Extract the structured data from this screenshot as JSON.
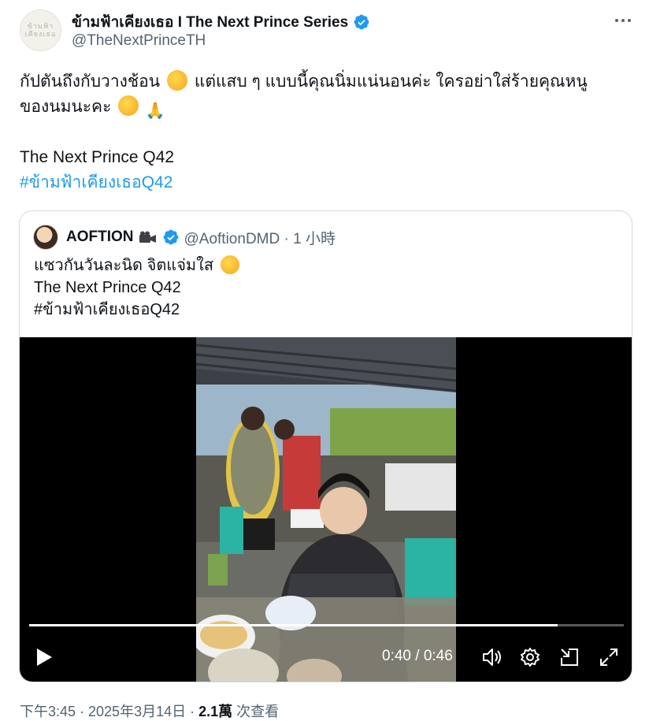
{
  "author": {
    "display_name": "ข้ามฟ้าเคียงเธอ I The Next Prince Series",
    "handle": "@TheNextPrinceTH",
    "avatar_logo_text": "ข้ามฟ้า เคียงเธอ",
    "verified_icon": "verified-badge-icon",
    "more_icon": "more-options-icon"
  },
  "tweet": {
    "line1_a": "กัปตันถึงกับวางช้อน",
    "line1_b": "แต่แสบ ๆ แบบนี้คุณนิ่มแน่นอนค่ะ ใครอย่าใส่ร้ายคุณหนู",
    "line2": "ของนมนะคะ",
    "line3": "The Next Prince Q42",
    "hashtag": "#ข้ามฟ้าเคียงเธอQ42"
  },
  "quoted": {
    "display_name": "AOFTION",
    "handle_time": "@AoftionDMD · 1 小時",
    "text_line1": "แซวกันวันละนิด จิตแจ่มใส",
    "text_line2": "The Next Prince Q42",
    "hashtag": "#ข้ามฟ้าเคียงเธอQ42",
    "video": {
      "time": "0:40 / 0:46",
      "progress": 0.889,
      "controls": [
        "play-icon",
        "volume-icon",
        "settings-icon",
        "picture-in-picture-icon",
        "fullscreen-icon"
      ]
    }
  },
  "footer": {
    "timestamp": "下午3:45 · 2025年3月14日 · ",
    "views_count": "2.1萬",
    "views_label": " 次查看"
  },
  "colors": {
    "accent": "#1d9bf0",
    "text": "#0f1419",
    "secondary": "#536471",
    "border": "#cfd9de"
  }
}
